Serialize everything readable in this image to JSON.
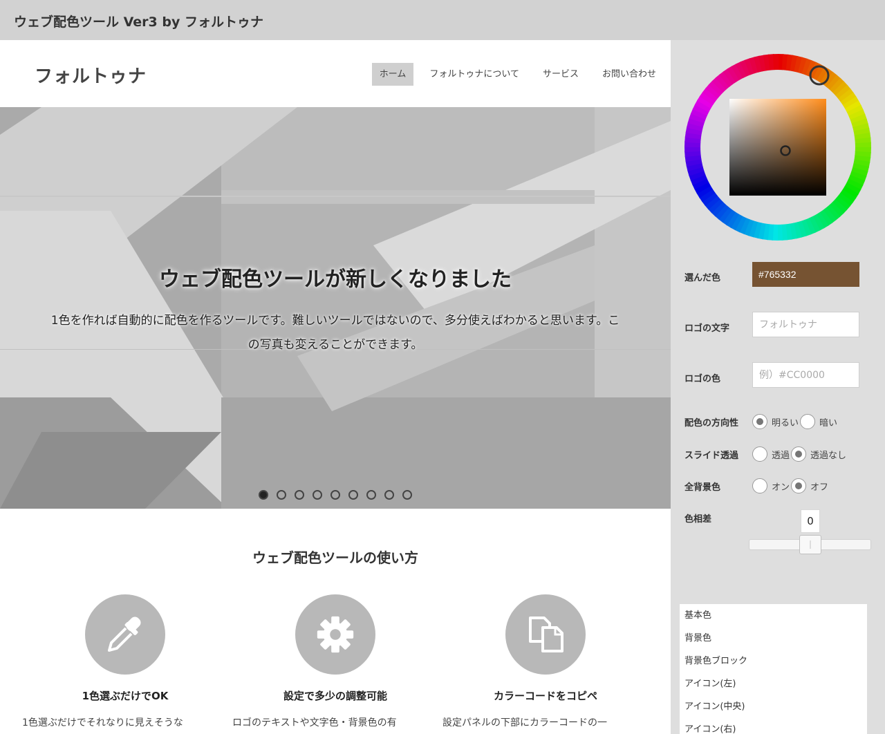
{
  "app": {
    "title": "ウェブ配色ツール Ver3 by フォルトゥナ"
  },
  "site": {
    "logo": "フォルトゥナ",
    "nav": [
      {
        "label": "ホーム",
        "active": true
      },
      {
        "label": "フォルトゥナについて",
        "active": false
      },
      {
        "label": "サービス",
        "active": false
      },
      {
        "label": "お問い合わせ",
        "active": false
      }
    ]
  },
  "hero": {
    "title": "ウェブ配色ツールが新しくなりました",
    "text": "1色を作れば自動的に配色を作るツールです。難しいツールではないので、多分使えばわかると思います。この写真も変えることができます。",
    "slide_count": 9,
    "active_slide": 1
  },
  "howto": {
    "title": "ウェブ配色ツールの使い方",
    "features": [
      {
        "icon": "eyedropper-icon",
        "title": "1色選ぶだけでOK",
        "desc": "1色選ぶだけでそれなりに見えそうな"
      },
      {
        "icon": "gear-icon",
        "title": "設定で多少の調整可能",
        "desc": "ロゴのテキストや文字色・背景色の有"
      },
      {
        "icon": "copy-icon",
        "title": "カラーコードをコピペ",
        "desc": "設定パネルの下部にカラーコードの一"
      }
    ]
  },
  "panel": {
    "selected_color_label": "選んだ色",
    "selected_color": "#765332",
    "logo_text_label": "ロゴの文字",
    "logo_text_placeholder": "フォルトゥナ",
    "logo_color_label": "ロゴの色",
    "logo_color_placeholder": "例）#CC0000",
    "direction_label": "配色の方向性",
    "direction_options": [
      "明るい",
      "暗い"
    ],
    "slide_label": "スライド透過",
    "slide_options": [
      "透過",
      "透過なし"
    ],
    "bg_label": "全背景色",
    "bg_options": [
      "オン",
      "オフ"
    ],
    "hue_label": "色相差",
    "hue_value": "0",
    "color_list": [
      "基本色",
      "背景色",
      "背景色ブロック",
      "アイコン(左)",
      "アイコン(中央)",
      "アイコン(右)"
    ]
  },
  "colors": {
    "accent": "#765332",
    "picker_hue": "#ff8c1a"
  }
}
